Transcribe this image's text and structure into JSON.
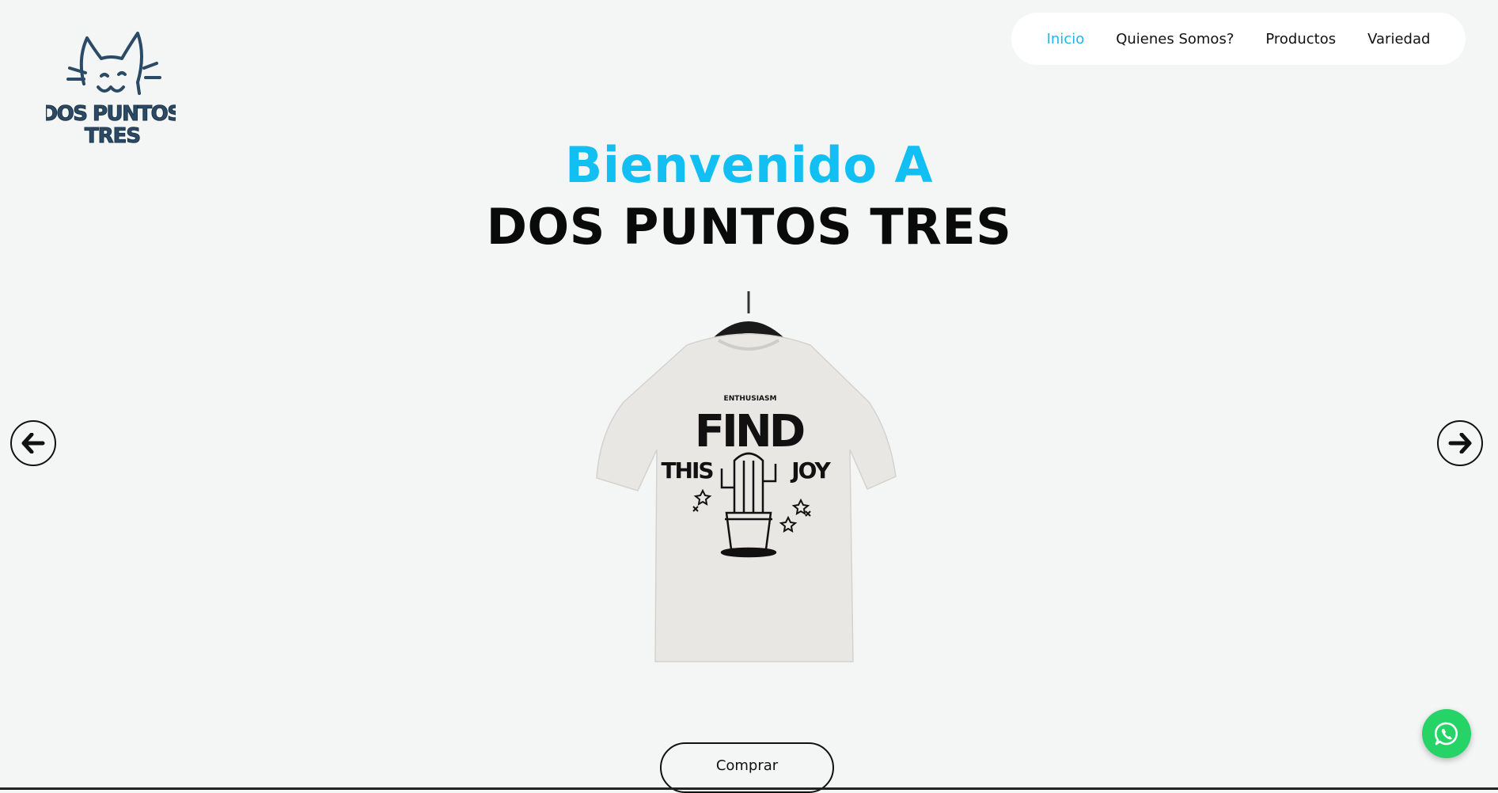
{
  "brand": {
    "logo_text_line1": "DOS PUNTOS",
    "logo_text_line2": "TRES",
    "logo_color": "#2b4a66"
  },
  "nav": {
    "items": [
      {
        "label": "Inicio",
        "active": true
      },
      {
        "label": "Quienes Somos?",
        "active": false
      },
      {
        "label": "Productos",
        "active": false
      },
      {
        "label": "Variedad",
        "active": false
      }
    ],
    "active_color": "#1cb8ec"
  },
  "hero": {
    "title_line1": "Bienvenido A",
    "title_line2": "DOS PUNTOS TRES",
    "accent_color": "#12bff2"
  },
  "carousel": {
    "prev_icon": "arrow-left-icon",
    "next_icon": "arrow-right-icon",
    "slide": {
      "image": "t-shirt-on-hanger",
      "print_top": "ENTHUSIASM",
      "print_main_1": "FIND",
      "print_main_2": "THIS",
      "print_main_3": "JOY"
    }
  },
  "cta": {
    "buy_label": "Comprar"
  },
  "whatsapp": {
    "icon": "whatsapp-icon",
    "color": "#25d366"
  }
}
